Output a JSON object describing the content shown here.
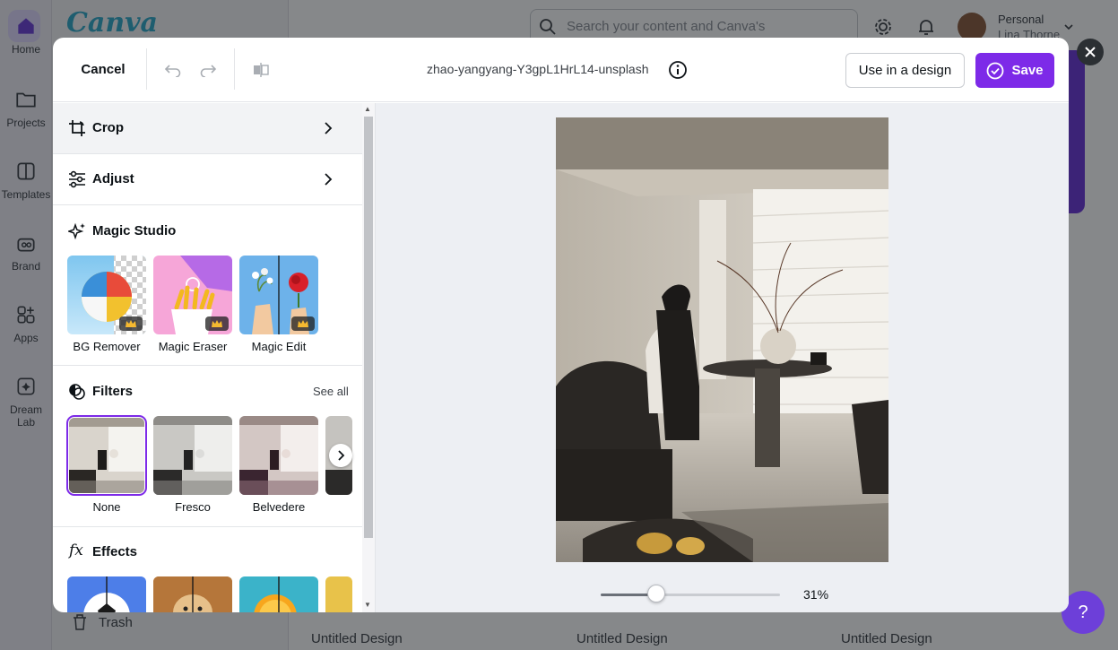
{
  "background": {
    "logo": "Canva",
    "search_placeholder": "Search your content and Canva's",
    "user": {
      "account": "Personal",
      "name": "Lina Thorne"
    },
    "rail": [
      {
        "label": "Home",
        "icon": "home-icon"
      },
      {
        "label": "Projects",
        "icon": "folder-icon"
      },
      {
        "label": "Templates",
        "icon": "templates-icon"
      },
      {
        "label": "Brand",
        "icon": "brand-icon"
      },
      {
        "label": "Apps",
        "icon": "apps-icon"
      },
      {
        "label": "Dream Lab",
        "icon": "dream-lab-icon"
      }
    ],
    "trash_label": "Trash",
    "help_label": "?",
    "cards": [
      "Untitled Design",
      "Untitled Design",
      "Untitled Design"
    ]
  },
  "editor": {
    "cancel_label": "Cancel",
    "filename": "zhao-yangyang-Y3gpL1HrL14-unsplash",
    "use_in_design_label": "Use in a design",
    "save_label": "Save",
    "panel": {
      "crop_label": "Crop",
      "adjust_label": "Adjust",
      "magic_studio_title": "Magic Studio",
      "magic_tools": [
        {
          "label": "BG Remover",
          "premium": true
        },
        {
          "label": "Magic Eraser",
          "premium": true
        },
        {
          "label": "Magic Edit",
          "premium": true
        }
      ],
      "filters_title": "Filters",
      "see_all_label": "See all",
      "filters": [
        {
          "label": "None",
          "selected": true
        },
        {
          "label": "Fresco",
          "selected": false
        },
        {
          "label": "Belvedere",
          "selected": false
        }
      ],
      "effects_title": "Effects"
    },
    "zoom": {
      "value": 0.31,
      "label": "31%"
    }
  },
  "colors": {
    "accent": "#7d2ae8",
    "overlay": "#0d1216"
  }
}
